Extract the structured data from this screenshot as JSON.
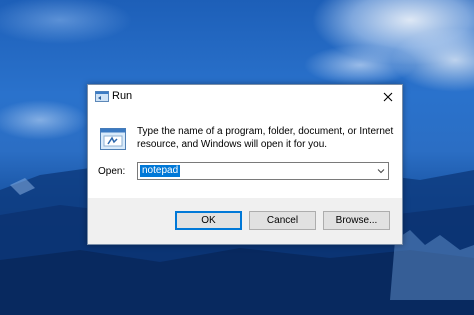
{
  "dialog": {
    "title": "Run",
    "title_icon": "run-icon",
    "close_icon": "close-icon",
    "program_icon": "run-program-icon",
    "description": "Type the name of a program, folder, document, or Internet resource, and Windows will open it for you.",
    "open_label": "Open:",
    "open_value": "notepad",
    "dropdown_icon": "chevron-down-icon",
    "buttons": {
      "ok": "OK",
      "cancel": "Cancel",
      "browse": "Browse..."
    }
  },
  "colors": {
    "selection": "#0078d7",
    "footer_bg": "#f0f0f0",
    "button_bg": "#e1e1e1"
  }
}
